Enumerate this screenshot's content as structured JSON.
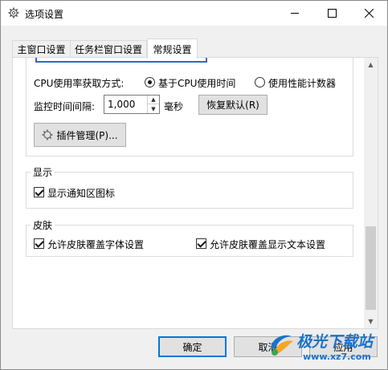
{
  "window": {
    "title": "选项设置",
    "icon": "gear-icon"
  },
  "tabs": [
    {
      "label": "主窗口设置",
      "active": false
    },
    {
      "label": "任务栏窗口设置",
      "active": false
    },
    {
      "label": "常规设置",
      "active": true
    }
  ],
  "cpu": {
    "label": "CPU使用率获取方式:",
    "option1": "基于CPU使用时间",
    "option2": "使用性能计数器",
    "selected": "option1"
  },
  "monitor": {
    "label": "监控时间间隔:",
    "value": "1,000",
    "unit": "毫秒",
    "reset_label": "恢复默认(R)"
  },
  "plugin": {
    "label": "插件管理(P)..."
  },
  "display": {
    "title": "显示",
    "show_tray_icon": {
      "label": "显示通知区图标",
      "checked": true
    }
  },
  "skin": {
    "title": "皮肤",
    "allow_font": {
      "label": "允许皮肤覆盖字体设置",
      "checked": true
    },
    "allow_text": {
      "label": "允许皮肤覆盖显示文本设置",
      "checked": true
    }
  },
  "footer": {
    "ok": "确定",
    "cancel": "取消",
    "apply": "应用"
  },
  "watermark": {
    "text": "极光下载站",
    "url": "www.xz7.com"
  },
  "colors": {
    "accent": "#0078d7",
    "watermark": "#1a73c8"
  }
}
